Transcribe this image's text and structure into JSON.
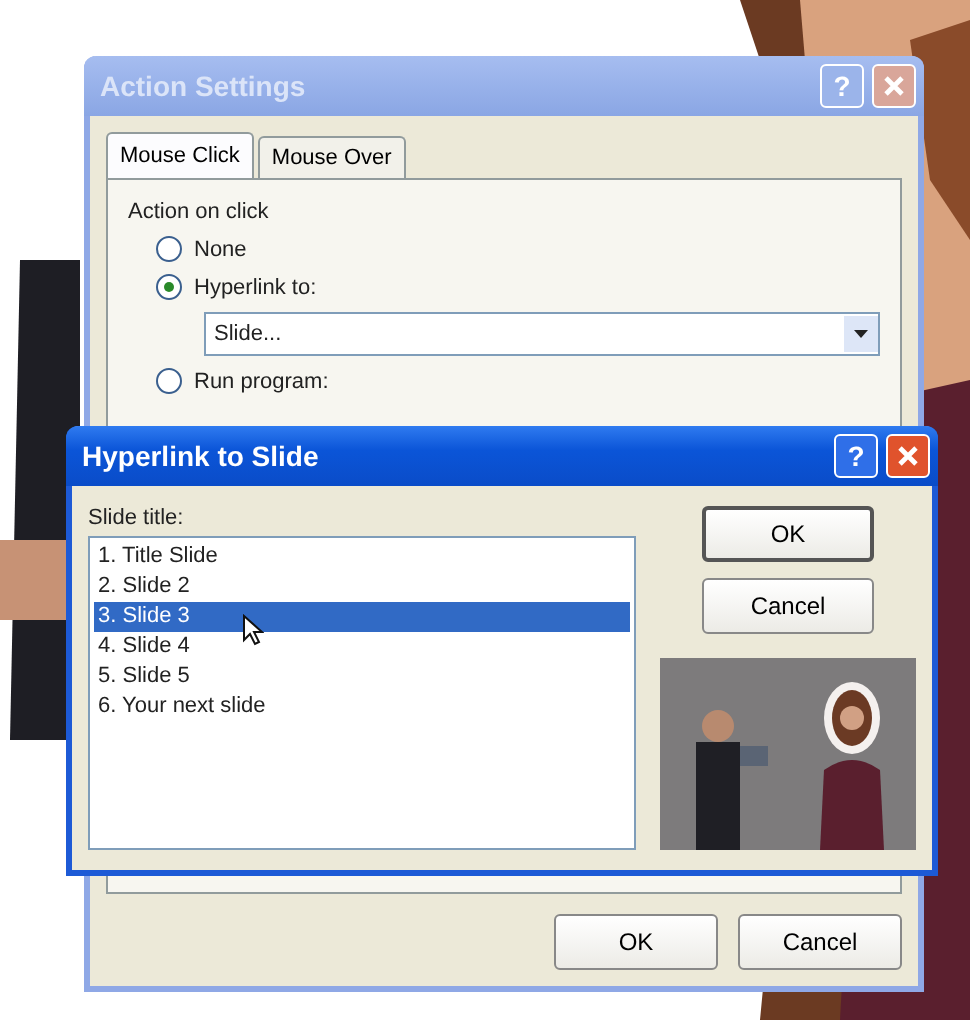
{
  "action_settings": {
    "title": "Action Settings",
    "active": false,
    "help": "?",
    "tabs": [
      {
        "label": "Mouse Click",
        "selected": true
      },
      {
        "label": "Mouse Over",
        "selected": false
      }
    ],
    "group_label": "Action on click",
    "options": [
      {
        "label": "None",
        "selected": false
      },
      {
        "label": "Hyperlink to:",
        "selected": true
      },
      {
        "label": "Run program:",
        "selected": false
      }
    ],
    "hyperlink_value": "Slide...",
    "buttons": [
      "OK",
      "Cancel"
    ]
  },
  "hyperlink_dialog": {
    "title": "Hyperlink to Slide",
    "active": true,
    "help": "?",
    "list_label": "Slide title:",
    "slides": [
      {
        "label": "1. Title Slide",
        "selected": false
      },
      {
        "label": "2. Slide 2",
        "selected": false
      },
      {
        "label": "3. Slide 3",
        "selected": true
      },
      {
        "label": "4. Slide 4",
        "selected": false
      },
      {
        "label": "5. Slide 5",
        "selected": false
      },
      {
        "label": "6. Your next slide",
        "selected": false
      }
    ],
    "buttons": [
      "OK",
      "Cancel"
    ]
  }
}
